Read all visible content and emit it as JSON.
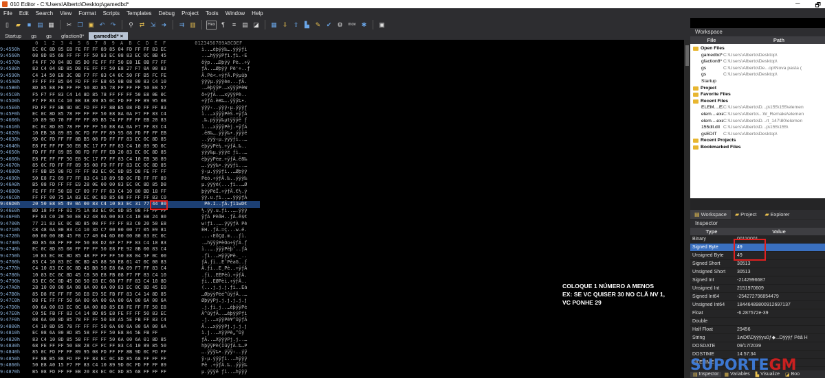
{
  "window": {
    "title": "010 Editor - C:\\Users\\Alberto\\Desktop\\gamedbd*",
    "min": "─",
    "max": "🗗"
  },
  "menu": [
    "File",
    "Edit",
    "Search",
    "View",
    "Format",
    "Scripts",
    "Templates",
    "Debug",
    "Project",
    "Tools",
    "Window",
    "Help"
  ],
  "toolbar": {
    "icons": [
      "new-file",
      "open-file",
      "save",
      "save-all",
      "print",
      "cut",
      "copy",
      "paste",
      "undo",
      "redo",
      "find",
      "replace",
      "find-next",
      "goto",
      "compare",
      "checksum",
      "hex-mode",
      "paragraph",
      "text-mode",
      "edit-as",
      "bookmark",
      "calculator",
      "import",
      "export",
      "histogram",
      "script",
      "template",
      "settings",
      "run-script",
      "close"
    ],
    "hex_label": "Hex",
    "mov_label": "mov"
  },
  "tabs": [
    {
      "label": "Startup"
    },
    {
      "label": "gs"
    },
    {
      "label": "gs"
    },
    {
      "label": "gfaction8*"
    },
    {
      "label": "gamedbd* ×",
      "active": true
    }
  ],
  "hex_header": {
    "cols": [
      "0",
      "1",
      "2",
      "3",
      "4",
      "5",
      "6",
      "7",
      "8",
      "9",
      "A",
      "B",
      "C",
      "D",
      "E",
      "F"
    ],
    "ascii": "0123456789ABCDEF"
  },
  "hex_rows": [
    {
      "addr": "9:4550h",
      "hex": "EC 0C 8D 85 E8 FE FF FF 89 85 04 FD FF FF 83 EC",
      "ascii": "ì..…èþÿÿ‰….ýÿÿƒì"
    },
    {
      "addr": "9:4560h",
      "hex": "08 8D 85 68 FF FF FF 50 83 EC 08 83 EC 0C 8B 45",
      "ascii": "..…hÿÿÿPƒì.ƒì.‹E"
    },
    {
      "addr": "9:4570h",
      "hex": "F4 FF 70 04 8D 85 D0 FE FF FF 50 E8 1E 0B F7 FF",
      "ascii": "ôÿp..…Ðþÿÿ Pè..÷ÿ"
    },
    {
      "addr": "9:4580h",
      "hex": "83 C4 04 8D 85 D8 FE FF FF 50 E8 27 F7 0A 00 83",
      "ascii": "ƒÄ..…Øþÿÿ Pè'÷..ƒ"
    },
    {
      "addr": "9:4590h",
      "hex": "C4 14 50 E8 3C 0B F7 FF 83 C4 0C 50 FF B5 FC FE",
      "ascii": "Ä.Pè<.÷ÿƒÄ.Pÿµüþ"
    },
    {
      "addr": "9:45A0h",
      "hex": "FF FF FF B5 04 FD FF FF E8 65 0B 08 00 83 C4 10",
      "ascii": "ÿÿÿµ.ýÿÿèe...ƒÄ."
    },
    {
      "addr": "9:45B0h",
      "hex": "8D 85 E8 FE FF FF 50 8D 85 78 FF FF FF 50 E8 57",
      "ascii": ".…èþÿÿP.…xÿÿÿPèW"
    },
    {
      "addr": "9:45C0h",
      "hex": "F5 F7 FF 83 C4 14 8D 85 78 FF FF FF 50 E8 0E 0C",
      "ascii": "õ÷ÿƒÄ..…xÿÿÿPè.."
    },
    {
      "addr": "9:45D0h",
      "hex": "F7 FF 83 C4 10 E8 38 89 85 0C FD FF FF 89 95 08",
      "ascii": "÷ÿƒÄ.è8‰….ýÿÿ‰•."
    },
    {
      "addr": "9:45E0h",
      "hex": "FD FF FF 8B 9D 0C FD FF FF 8B B5 08 FD FF FF 83",
      "ascii": "ýÿÿ‹..ýÿÿ‹µ.ýÿÿƒ"
    },
    {
      "addr": "9:45F0h",
      "hex": "EC 0C 8D 85 78 FF FF FF 50 E8 8A 0A F7 FF 83 C4",
      "ascii": "ì..…xÿÿÿPèŠ.÷ÿƒÄ"
    },
    {
      "addr": "9:4600h",
      "hex": "10 89 9D 70 FF FF FF 89 B5 74 FF FF FF EB 20 83",
      "ascii": ".‰.pÿÿÿ‰µtÿÿÿë ƒ"
    },
    {
      "addr": "9:4610h",
      "hex": "EC 0C 8D 85 78 FF FF FF 50 E8 6A 0A F7 FF 83 C4",
      "ascii": "ì..…xÿÿÿPèj.÷ÿƒÄ"
    },
    {
      "addr": "9:4620h",
      "hex": "10 EB 38 89 85 0C FD FF FF 89 95 08 FD FF FF EB",
      "ascii": ".ë8‰….ýÿÿ‰•.ýÿÿë"
    },
    {
      "addr": "9:4630h",
      "hex": "9D 0C FD FF FF 8B B5 08 FD FF FF 83 EC 0C 8D 85",
      "ascii": "..ýÿÿ‹µ.ýÿÿƒì..…"
    },
    {
      "addr": "9:4640h",
      "hex": "E8 FE FF FF 50 E8 BC 17 F7 FF 83 C4 10 89 9D 0C",
      "ascii": "èþÿÿPè¼.÷ÿƒÄ.‰.."
    },
    {
      "addr": "9:4650h",
      "hex": "FD FF FF 89 B5 08 FD FF FF EB 20 83 EC 0C 8D 85",
      "ascii": "ýÿÿ‰µ.ýÿÿë ƒì..…"
    },
    {
      "addr": "9:4660h",
      "hex": "E8 FE FF FF 50 E8 9C 17 F7 FF 83 C4 10 EB 38 89",
      "ascii": "èþÿÿPèœ.÷ÿƒÄ.ë8‰"
    },
    {
      "addr": "9:4670h",
      "hex": "85 0C FD FF FF 89 95 08 FD FF FF 83 EC 0C 8D 85",
      "ascii": "….ýÿÿ‰•.ýÿÿƒì..…"
    },
    {
      "addr": "9:4680h",
      "hex": "FF 8B B5 08 FD FF FF 83 EC 0C 8D 85 D8 FE FF FF",
      "ascii": "ÿ‹µ.ýÿÿƒì..…Øþÿÿ"
    },
    {
      "addr": "9:4690h",
      "hex": "50 E8 F2 09 F7 FF 83 C4 10 89 9D 0C FD FF FF 89",
      "ascii": "Pèò.÷ÿƒÄ.‰..ýÿÿ‰"
    },
    {
      "addr": "9:46A0h",
      "hex": "B5 08 FD FF FF E9 28 0E 00 00 83 EC 0C 8D 85 D8",
      "ascii": "µ.ýÿÿé(...ƒì..…Ø"
    },
    {
      "addr": "9:46B0h",
      "hex": "FE FF FF 50 E8 CF 09 F7 FF 83 C4 10 80 BD 18 FF",
      "ascii": "þÿÿPèÏ.÷ÿƒÄ.€½.ÿ"
    },
    {
      "addr": "9:46C0h",
      "hex": "FF FF 00 75 1A 83 EC 0C 8D 85 08 FF FF FF 83 C0",
      "ascii": "ÿÿ.u.ƒì..….ÿÿÿƒÀ"
    },
    {
      "addr": "9:46D0h",
      "hex": "20 50 E8 05 49 0A 00 83 C4 10 83 EC 31 77 44 80",
      "ascii": " Pè.I..ƒÄ.ƒì1wD€",
      "selected": true
    },
    {
      "addr": "9:46E0h",
      "hex": "BD 18 FF FF 01 75 1A 83 EC 0C 8D 85 08 FF FF FF",
      "ascii": "½.ÿÿ.u.ƒì..….ÿÿÿ"
    },
    {
      "addr": "9:46F0h",
      "hex": "FF 83 C0 20 50 E8 E2 48 0A 00 83 C4 10 EB 24 80",
      "ascii": "ÿƒÀ PèâH..ƒÄ.ë$€"
    },
    {
      "addr": "9:4700h",
      "hex": "77 21 83 EC 0C 8D 85 08 FF FF FF 83 C0 20 50 E8",
      "ascii": "w!ƒì..….ÿÿÿƒÀ Pè"
    },
    {
      "addr": "9:4710h",
      "hex": "C8 48 0A 00 83 C4 10 3D C7 00 00 00 77 05 E9 81",
      "ascii": "ÈH..ƒÄ.=Ç...w.é."
    },
    {
      "addr": "9:4720h",
      "hex": "00 00 00 8B 45 F0 C7 40 04 6D 00 00 00 83 EC 0C",
      "ascii": "...‹EðÇ@.m...ƒì."
    },
    {
      "addr": "9:4730h",
      "hex": "8D 85 68 FF FF FF 50 E8 D2 6F F7 FF 83 C4 10 83",
      "ascii": ".…hÿÿÿPèÒo÷ÿƒÄ.ƒ"
    },
    {
      "addr": "9:4740h",
      "hex": "EC 0C 8D 85 08 FF FF FF 50 E8 FE 92 0B 00 83 C4",
      "ascii": "ì..….ÿÿÿPèþ’..ƒÄ"
    },
    {
      "addr": "9:4750h",
      "hex": "10 83 EC 0C 8D 85 48 FF FF FF 50 E8 04 5F 0C 00",
      "ascii": ".ƒì..…HÿÿÿPè._.."
    },
    {
      "addr": "9:4760h",
      "hex": "83 C4 10 83 EC 0C 8D 45 88 50 E8 61 47 0C 00 83",
      "ascii": "ƒÄ.ƒì..EˆPèaG..ƒ"
    },
    {
      "addr": "9:4770h",
      "hex": "C4 10 83 EC 0C 8D 45 B8 50 E8 0A 09 F7 FF 83 C4",
      "ascii": "Ä.ƒì..E¸Pè..÷ÿƒÄ"
    },
    {
      "addr": "9:4780h",
      "hex": "10 83 EC 0C 8D 45 C8 50 E8 FB 08 F7 FF 83 C4 10",
      "ascii": ".ƒì..EÈPèû.÷ÿƒÄ."
    },
    {
      "addr": "9:4790h",
      "hex": "83 EC 0C 8D 45 D8 50 E8 EC 08 F7 FF 83 C4 10 8D",
      "ascii": "ƒì..EØPèì.÷ÿƒÄ.."
    },
    {
      "addr": "9:47A0h",
      "hex": "28 10 00 00 6A 00 6A 00 6A 00 83 EC 0C 8D 45 E0",
      "ascii": "(...j.j.j.ƒì..Eà"
    },
    {
      "addr": "9:47B0h",
      "hex": "85 D8 FE FF FF 50 E8 E9 5E FB FF 83 C4 14 8D 85",
      "ascii": "…ØþÿÿPèé^ûÿƒÄ..…"
    },
    {
      "addr": "9:47C0h",
      "hex": "D8 FE FF FF 50 6A 00 6A 00 6A 00 6A 00 6A 00 6A",
      "ascii": "ØþÿÿPj.j.j.j.j.j"
    },
    {
      "addr": "9:47D0h",
      "hex": "00 6A 00 83 EC 0C 6A 00 8D 85 E8 FE FF FF 50 E8",
      "ascii": ".j.ƒì.j..…èþÿÿPè"
    },
    {
      "addr": "9:47E0h",
      "hex": "C0 5E FB FF 83 C4 14 8D 85 E8 FE FF FF 50 83 EC",
      "ascii": "À^ûÿƒÄ..…èþÿÿPƒì"
    },
    {
      "addr": "9:47F0h",
      "hex": "08 6A 00 8D 85 78 FF FF 50 E8 A5 5E FB FF 83 C4",
      "ascii": ".j..…xÿÿPè¥^ûÿƒÄ"
    },
    {
      "addr": "9:4800h",
      "hex": "C4 10 8D 85 78 FF FF FF 50 6A 00 6A 00 6A 00 6A",
      "ascii": "Ä..…xÿÿÿPj.j.j.j"
    },
    {
      "addr": "9:4810h",
      "hex": "EC 08 6A 00 8D 85 58 FF FF 50 E8 84 5E FB FF",
      "ascii": "ì.j..…XÿÿPè„^ûÿ"
    },
    {
      "addr": "9:4820h",
      "hex": "83 C4 10 8D 85 58 FF FF FF 50 6A 00 6A 01 8D 85",
      "ascii": "ƒÄ..…XÿÿÿPj.j..…"
    },
    {
      "addr": "9:4830h",
      "hex": "68 FE FF FF 50 E8 28 CF FC FF 83 C4 10 89 85 50",
      "ascii": "hþÿÿPè(ÏüÿƒÄ.‰…P"
    },
    {
      "addr": "9:4840h",
      "hex": "85 0C FD FF FF 89 95 08 FD FF FF 8B 9D 0C FD FF",
      "ascii": "….ýÿÿ‰•.ýÿÿ‹..ýÿ"
    },
    {
      "addr": "9:4850h",
      "hex": "FF 8B B5 08 FD FF FF 83 EC 0C 8D 85 68 FF FF FF",
      "ascii": "ÿ‹µ.ýÿÿƒì..…hÿÿÿ"
    },
    {
      "addr": "9:4860h",
      "hex": "50 E8 A0 15 F7 FF 83 C4 10 89 9D 0C FD FF FF 89",
      "ascii": "Pè .÷ÿƒÄ.‰..ýÿÿ‰"
    },
    {
      "addr": "9:4870h",
      "hex": "B5 08 FD FF FF EB 20 83 EC 0C 8D 85 68 FF FF FF",
      "ascii": "µ.ýÿÿë ƒì..…hÿÿÿ"
    }
  ],
  "annotation": {
    "line1": "COLOQUE 1 NÚMERO A MENOS",
    "line2": "EX: SE VC QUISER 30 NO CLÃ NV 1,",
    "line3": "VC PONHE 29"
  },
  "workspace": {
    "title": "Workspace",
    "col_file": "File",
    "col_path": "Path",
    "tree": [
      {
        "name": "Open Files",
        "path": "",
        "group": true
      },
      {
        "name": "gamedbd*",
        "path": "C:\\Users\\Alberto\\Desktop\\"
      },
      {
        "name": "gfaction8*",
        "path": "C:\\Users\\Alberto\\Desktop\\"
      },
      {
        "name": "gs",
        "path": "C:\\Users\\Alberto\\De...op\\Nova pasta ("
      },
      {
        "name": "gs",
        "path": "C:\\Users\\Alberto\\Desktop\\"
      },
      {
        "name": "Startup",
        "path": ""
      },
      {
        "name": "Project",
        "path": "",
        "group": true
      },
      {
        "name": "Favorite Files",
        "path": "",
        "group": true
      },
      {
        "name": "Recent Files",
        "path": "",
        "group": true
      },
      {
        "name": "ELEM....EXE",
        "path": "C:\\Users\\Alberto\\D...p\\155\\155\\elemen"
      },
      {
        "name": "elem....exe",
        "path": "C:\\Users\\Alberto\\...W_Remake\\elemen"
      },
      {
        "name": "elem....exe",
        "path": "C:\\Users\\Alberto\\D...rt_147\\80\\elemen"
      },
      {
        "name": "155dll.dll",
        "path": "C:\\Users\\Alberto\\D...p\\155\\155\\"
      },
      {
        "name": "gsEDIT",
        "path": "C:\\Users\\Alberto\\Desktop\\"
      },
      {
        "name": "Recent Projects",
        "path": "",
        "group": true
      },
      {
        "name": "Bookmarked Files",
        "path": "",
        "group": true
      }
    ]
  },
  "panel_tabs": [
    {
      "label": "Workspace",
      "active": true
    },
    {
      "label": "Project"
    },
    {
      "label": "Explorer"
    }
  ],
  "inspector": {
    "title": "Inspector",
    "col_type": "Type",
    "col_value": "Value",
    "rows": [
      {
        "type": "Binary",
        "value": "00110001"
      },
      {
        "type": "Signed Byte",
        "value": "49",
        "selected": true
      },
      {
        "type": "Unsigned Byte",
        "value": "49"
      },
      {
        "type": "Signed Short",
        "value": "30513"
      },
      {
        "type": "Unsigned Short",
        "value": "30513"
      },
      {
        "type": "Signed Int",
        "value": "-2142996687"
      },
      {
        "type": "Unsigned Int",
        "value": "2151970609"
      },
      {
        "type": "Signed Int64",
        "value": "-254272796854479"
      },
      {
        "type": "Unsigned Int64",
        "value": "18446489800912697137"
      },
      {
        "type": "Float",
        "value": "-6.287572e-39"
      },
      {
        "type": "Double",
        "value": ""
      },
      {
        "type": "Half Float",
        "value": "29456"
      },
      {
        "type": "String",
        "value": "1wD€\\Dÿÿÿyu0ƒ◆...Dÿÿÿƒ Pèâ H"
      },
      {
        "type": "DOSDATE",
        "value": "09/17/2039"
      },
      {
        "type": "DOSTIME",
        "value": "14:57:34"
      },
      {
        "type": "FILETIME",
        "value": ""
      }
    ]
  },
  "bottom_tabs": [
    {
      "label": "Inspector",
      "active": true
    },
    {
      "label": "Variables"
    },
    {
      "label": "Visualize"
    },
    {
      "label": "Boo"
    }
  ],
  "watermark": {
    "part1": "SUPORTE",
    "part2": "GM"
  }
}
